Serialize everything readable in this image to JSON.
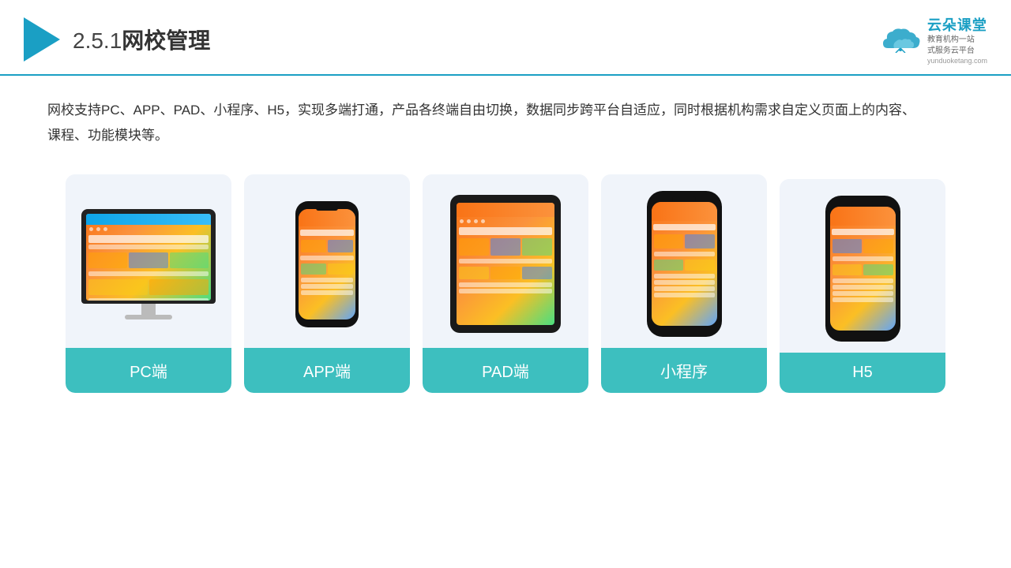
{
  "header": {
    "section_number": "2.5.1",
    "title": "网校管理",
    "brand_name": "云朵课堂",
    "brand_url": "yunduoketang.com",
    "brand_slogan_line1": "教育机构一站",
    "brand_slogan_line2": "式服务云平台"
  },
  "description": "网校支持PC、APP、PAD、小程序、H5，实现多端打通，产品各终端自由切换，数据同步跨平台自适应，同时根据机构需求自定义页面上的内容、课程、功能模块等。",
  "cards": [
    {
      "id": "pc",
      "label": "PC端",
      "device_type": "monitor"
    },
    {
      "id": "app",
      "label": "APP端",
      "device_type": "phone_app"
    },
    {
      "id": "pad",
      "label": "PAD端",
      "device_type": "tablet"
    },
    {
      "id": "mini",
      "label": "小程序",
      "device_type": "phone_mini"
    },
    {
      "id": "h5",
      "label": "H5",
      "device_type": "phone_h5"
    }
  ],
  "colors": {
    "accent": "#1a9fc4",
    "teal": "#3dbfbf",
    "card_bg": "#eef2f8"
  }
}
